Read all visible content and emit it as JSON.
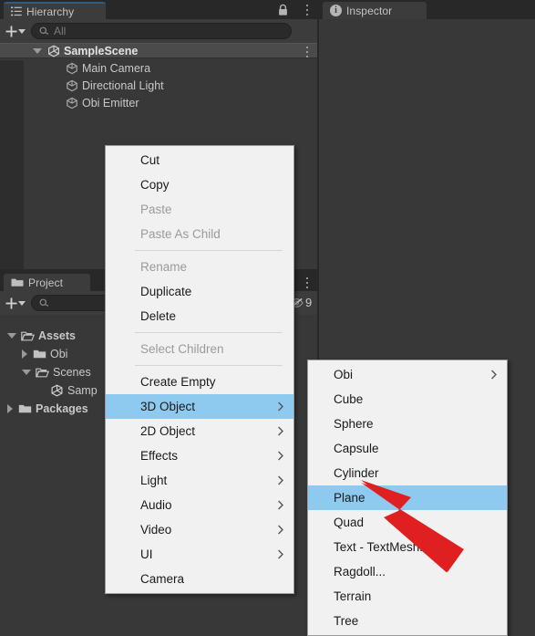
{
  "app": {
    "name": "Unity Editor",
    "theme": "dark",
    "accent_color": "#2c5d87",
    "menu_highlight_color": "#8ecaf0",
    "annotation_color": "#e02020",
    "panel_bg": "#383838",
    "tabstrip_bg": "#282828",
    "menu_bg": "#f1f1f1"
  },
  "hierarchy": {
    "tab_label": "Hierarchy",
    "tab_icon": "hierarchy-icon",
    "lock_icon": "lock-icon",
    "menu_icon": "kebab-menu-icon",
    "add_button_label": "+",
    "add_button_icon": "plus-icon",
    "add_dropdown_icon": "chevron-down-icon",
    "search": {
      "icon": "search-icon",
      "value": "",
      "placeholder": "All"
    },
    "scene": {
      "name": "SampleScene",
      "icon": "unity-scene-icon",
      "expanded": true,
      "row_menu_icon": "kebab-menu-icon"
    },
    "objects": [
      {
        "name": "Main Camera",
        "icon": "gameobject-cube-icon"
      },
      {
        "name": "Directional Light",
        "icon": "gameobject-cube-icon"
      },
      {
        "name": "Obi Emitter",
        "icon": "gameobject-cube-icon"
      }
    ]
  },
  "project": {
    "tab_label": "Project",
    "tab_icon": "folder-icon",
    "menu_icon": "kebab-menu-icon",
    "add_button_label": "+",
    "add_button_icon": "plus-icon",
    "add_dropdown_icon": "chevron-down-icon",
    "search": {
      "icon": "search-icon",
      "value": "",
      "placeholder": ""
    },
    "badge": {
      "icon": "hidden-eye-icon",
      "count": "9"
    },
    "tree": [
      {
        "label": "Assets",
        "icon": "folder-open-icon",
        "expanded": true,
        "indent": 0,
        "bold": true
      },
      {
        "label": "Obi",
        "icon": "folder-icon",
        "expanded": false,
        "indent": 1,
        "bold": false
      },
      {
        "label": "Scenes",
        "icon": "folder-open-icon",
        "expanded": true,
        "indent": 1,
        "bold": false
      },
      {
        "label": "Samp",
        "icon": "unity-scene-icon",
        "expanded": null,
        "indent": 2,
        "bold": false
      },
      {
        "label": "Packages",
        "icon": "folder-icon",
        "expanded": false,
        "indent": 0,
        "bold": true
      }
    ]
  },
  "inspector": {
    "tab_label": "Inspector",
    "tab_icon": "info-icon",
    "content": ""
  },
  "context_menu": {
    "items": [
      {
        "label": "Cut",
        "disabled": false,
        "submenu": false,
        "selected": false,
        "separator_after": false
      },
      {
        "label": "Copy",
        "disabled": false,
        "submenu": false,
        "selected": false,
        "separator_after": false
      },
      {
        "label": "Paste",
        "disabled": true,
        "submenu": false,
        "selected": false,
        "separator_after": false
      },
      {
        "label": "Paste As Child",
        "disabled": true,
        "submenu": false,
        "selected": false,
        "separator_after": true
      },
      {
        "label": "Rename",
        "disabled": true,
        "submenu": false,
        "selected": false,
        "separator_after": false
      },
      {
        "label": "Duplicate",
        "disabled": false,
        "submenu": false,
        "selected": false,
        "separator_after": false
      },
      {
        "label": "Delete",
        "disabled": false,
        "submenu": false,
        "selected": false,
        "separator_after": true
      },
      {
        "label": "Select Children",
        "disabled": true,
        "submenu": false,
        "selected": false,
        "separator_after": true
      },
      {
        "label": "Create Empty",
        "disabled": false,
        "submenu": false,
        "selected": false,
        "separator_after": false
      },
      {
        "label": "3D Object",
        "disabled": false,
        "submenu": true,
        "selected": true,
        "separator_after": false
      },
      {
        "label": "2D Object",
        "disabled": false,
        "submenu": true,
        "selected": false,
        "separator_after": false
      },
      {
        "label": "Effects",
        "disabled": false,
        "submenu": true,
        "selected": false,
        "separator_after": false
      },
      {
        "label": "Light",
        "disabled": false,
        "submenu": true,
        "selected": false,
        "separator_after": false
      },
      {
        "label": "Audio",
        "disabled": false,
        "submenu": true,
        "selected": false,
        "separator_after": false
      },
      {
        "label": "Video",
        "disabled": false,
        "submenu": true,
        "selected": false,
        "separator_after": false
      },
      {
        "label": "UI",
        "disabled": false,
        "submenu": true,
        "selected": false,
        "separator_after": false
      },
      {
        "label": "Camera",
        "disabled": false,
        "submenu": false,
        "selected": false,
        "separator_after": false
      }
    ]
  },
  "submenu_3d_object": {
    "parent": "3D Object",
    "items": [
      {
        "label": "Obi",
        "submenu": true,
        "selected": false
      },
      {
        "label": "Cube",
        "submenu": false,
        "selected": false
      },
      {
        "label": "Sphere",
        "submenu": false,
        "selected": false
      },
      {
        "label": "Capsule",
        "submenu": false,
        "selected": false
      },
      {
        "label": "Cylinder",
        "submenu": false,
        "selected": false
      },
      {
        "label": "Plane",
        "submenu": false,
        "selected": true
      },
      {
        "label": "Quad",
        "submenu": false,
        "selected": false
      },
      {
        "label": "Text - TextMeshPro",
        "submenu": false,
        "selected": false
      },
      {
        "label": "Ragdoll...",
        "submenu": false,
        "selected": false
      },
      {
        "label": "Terrain",
        "submenu": false,
        "selected": false
      },
      {
        "label": "Tree",
        "submenu": false,
        "selected": false
      }
    ]
  },
  "annotation": {
    "type": "arrow",
    "points_to": "Plane",
    "color": "#e02020"
  }
}
